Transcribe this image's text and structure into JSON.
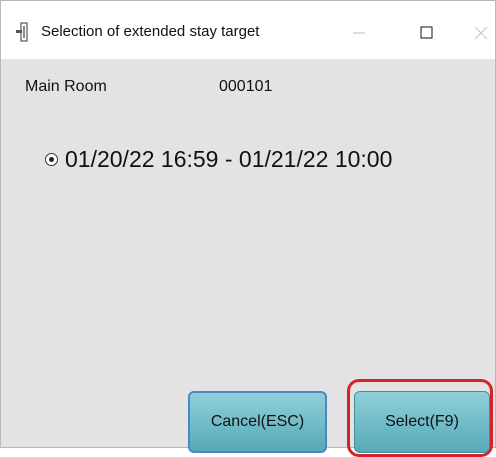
{
  "window": {
    "title": "Selection of extended stay target",
    "icon": "door-key-icon",
    "controls": [
      "minimize-icon",
      "maximize-icon",
      "close-icon"
    ]
  },
  "room": {
    "label": "Main Room",
    "number": "000101"
  },
  "options": [
    {
      "text": "01/20/22 16:59 - 01/21/22 10:00",
      "selected": true
    }
  ],
  "buttons": {
    "cancel": "Cancel(ESC)",
    "select": "Select(F9)"
  },
  "colors": {
    "button_top": "#8fd0d9",
    "button_bottom": "#56aab8",
    "highlight": "#d8222b",
    "background": "#e3e3e3"
  }
}
